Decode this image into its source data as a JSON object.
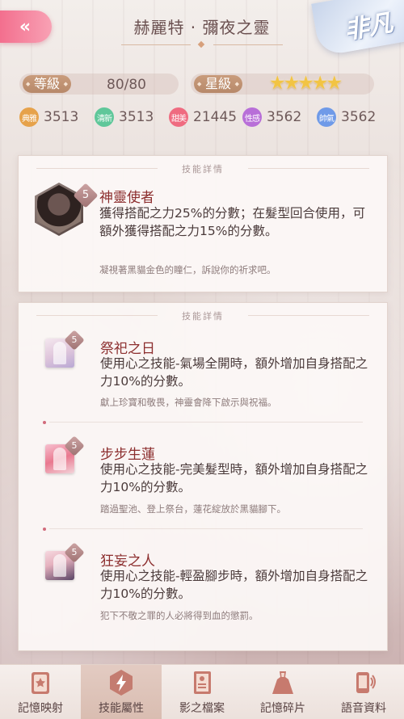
{
  "header": {
    "back_icon": "«",
    "title": "赫麗特 · 彌夜之靈",
    "rarity": "非凡"
  },
  "stats": {
    "level_label": "等級",
    "level_value": "80/80",
    "star_label": "星級",
    "stars": 5,
    "attributes": [
      {
        "label": "典雅",
        "value": "3513",
        "color": "#e6a24b"
      },
      {
        "label": "清新",
        "value": "3513",
        "color": "#5fc79a"
      },
      {
        "label": "甜美",
        "value": "21445",
        "color": "#ef6b80"
      },
      {
        "label": "性感",
        "value": "3562",
        "color": "#b86fd8"
      },
      {
        "label": "帥氣",
        "value": "3562",
        "color": "#6f9ae8"
      }
    ]
  },
  "main_skill": {
    "header": "技能詳情",
    "level": "5",
    "name": "神靈使者",
    "desc": "獲得搭配之力25%的分數；在髮型回合使用，可額外獲得搭配之力15%的分數。",
    "flavor": "凝視著黑貓金色的瞳仁，訴說你的祈求吧。"
  },
  "sub_skills": {
    "header": "技能詳情",
    "items": [
      {
        "level": "5",
        "name": "祭祀之日",
        "desc": "使用心之技能-氣場全開時，額外增加自身搭配之力10%的分數。",
        "flavor": "獻上珍寶和敬畏，神靈會降下啟示與祝福。"
      },
      {
        "level": "5",
        "name": "步步生蓮",
        "desc": "使用心之技能-完美髮型時，額外增加自身搭配之力10%的分數。",
        "flavor": "踏過聖池、登上祭台，蓮花綻放於黑貓腳下。"
      },
      {
        "level": "5",
        "name": "狂妄之人",
        "desc": "使用心之技能-輕盈腳步時，額外增加自身搭配之力10%的分數。",
        "flavor": "犯下不敬之罪的人必將得到血的懲罰。"
      }
    ]
  },
  "tabs": [
    {
      "label": "記憶映射",
      "icon": "card-icon"
    },
    {
      "label": "技能屬性",
      "icon": "lightning-icon",
      "active": true
    },
    {
      "label": "影之檔案",
      "icon": "document-icon"
    },
    {
      "label": "記憶碎片",
      "icon": "dress-icon"
    },
    {
      "label": "語音資料",
      "icon": "phone-icon"
    }
  ]
}
